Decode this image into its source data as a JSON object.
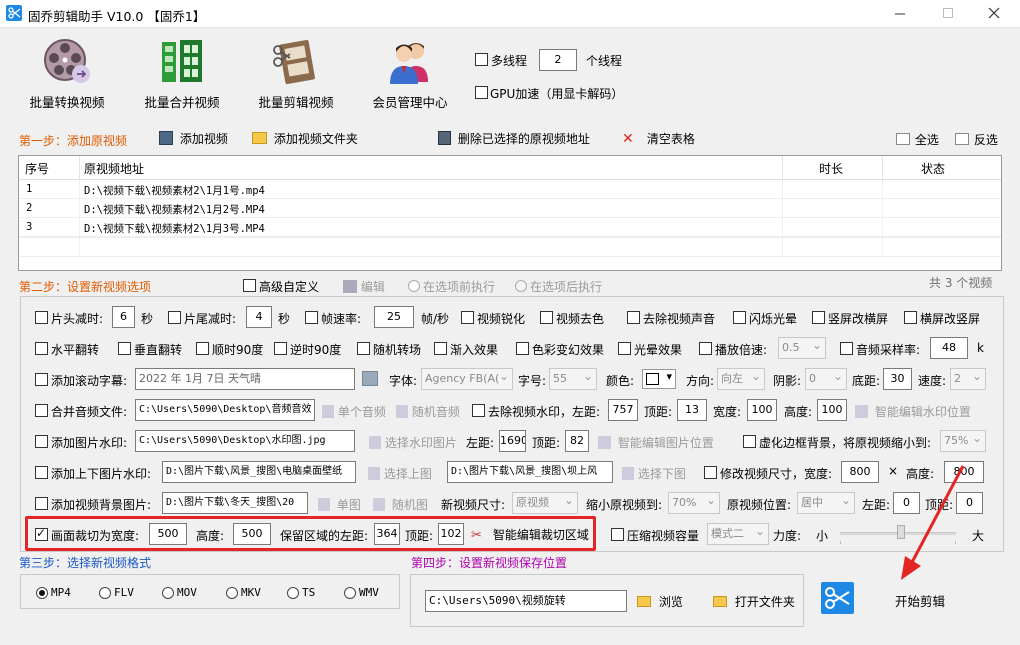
{
  "window": {
    "title": "固乔剪辑助手 V10.0 【固乔1】"
  },
  "toolbar": {
    "convert_label": "批量转换视频",
    "merge_label": "批量合并视频",
    "cut_label": "批量剪辑视频",
    "member_label": "会员管理中心",
    "multithread_label": "多线程",
    "thread_count": "2",
    "thread_unit": "个线程",
    "gpu_label": "GPU加速（用显卡解码）"
  },
  "step1": {
    "title": "第一步：添加原视频",
    "add_video": "添加视频",
    "add_folder": "添加视频文件夹",
    "delete_selected": "删除已选择的原视频地址",
    "clear_table": "清空表格",
    "select_all": "全选",
    "invert": "反选"
  },
  "table": {
    "headers": [
      "序号",
      "原视频地址",
      "时长",
      "状态"
    ],
    "rows": [
      [
        "1",
        "D:\\视频下载\\视频素材2\\1月1号.mp4",
        "",
        ""
      ],
      [
        "2",
        "D:\\视频下载\\视频素材2\\1月2号.MP4",
        "",
        ""
      ],
      [
        "3",
        "D:\\视频下载\\视频素材2\\1月3号.MP4",
        "",
        ""
      ]
    ]
  },
  "step2": {
    "title": "第二步：设置新视频选项",
    "advanced": "高级自定义",
    "edit": "编辑",
    "before_exec": "在选项前执行",
    "after_exec": "在选项后执行",
    "count_text": "共 3 个视频"
  },
  "opts": {
    "head_cut": "片头减时:",
    "head_val": "6",
    "sec1": "秒",
    "tail_cut": "片尾减时:",
    "tail_val": "4",
    "sec2": "秒",
    "fps": "帧速率:",
    "fps_val": "25",
    "fps_unit": "帧/秒",
    "sharpen": "视频锐化",
    "decolor": "视频去色",
    "mute": "去除视频声音",
    "flash": "闪烁光晕",
    "v2h": "竖屏改横屏",
    "h2v": "横屏改竖屏",
    "hflip": "水平翻转",
    "vflip": "垂直翻转",
    "rot90cw": "顺时90度",
    "rot90ccw": "逆时90度",
    "random_trans": "随机转场",
    "fade_in": "渐入效果",
    "color_effect": "色彩变幻效果",
    "halo": "光晕效果",
    "speed": "播放倍速:",
    "speed_val": "0.5",
    "sample_rate": "音频采样率:",
    "sample_val": "48",
    "sample_unit": "k",
    "scroll_sub": "添加滚动字幕:",
    "scroll_text": "2022 年 1月 7日 天气晴",
    "font_label": "字体:",
    "font_val": "Agency FB(A(",
    "size_label": "字号:",
    "size_val": "55",
    "color_label": "颜色:",
    "direction_label": "方向:",
    "direction_val": "向左",
    "shadow_label": "阴影:",
    "shadow_val": "0",
    "bottom_label": "底距:",
    "bottom_val": "30",
    "speed2_label": "速度:",
    "speed2_val": "2",
    "merge_audio": "合并音频文件:",
    "merge_audio_path": "C:\\Users\\5090\\Desktop\\音频音效",
    "single_audio": "单个音频",
    "random_audio": "随机音频",
    "remove_wm": "去除视频水印，左距:",
    "wm_left": "757",
    "wm_top_label": "顶距:",
    "wm_top": "13",
    "wm_w_label": "宽度:",
    "wm_w": "100",
    "wm_h_label": "高度:",
    "wm_h": "100",
    "smart_wm": "智能编辑水印位置",
    "img_wm": "添加图片水印:",
    "img_wm_path": "C:\\Users\\5090\\Desktop\\水印图.jpg",
    "choose_wm_img": "选择水印图片",
    "img_left_label": "左距:",
    "img_left": "1690",
    "img_top_label": "顶距:",
    "img_top": "82",
    "smart_img": "智能编辑图片位置",
    "blur_border": "虚化边框背景，将原视频缩小到:",
    "blur_val": "75%",
    "tb_wm": "添加上下图片水印:",
    "top_img_path": "D:\\图片下载\\风景_搜图\\电脑桌面壁纸",
    "choose_top": "选择上图",
    "bottom_img_path": "D:\\图片下载\\风景_搜图\\坝上风",
    "choose_bottom": "选择下图",
    "resize": "修改视频尺寸，宽度:",
    "resize_w": "800",
    "times": "×",
    "resize_h_label": "高度:",
    "resize_h": "800",
    "bg_img": "添加视频背景图片:",
    "bg_path": "D:\\图片下载\\冬天_搜图\\20",
    "single_img": "单图",
    "random_img": "随机图",
    "new_size_label": "新视频尺寸:",
    "new_size_val": "原视频",
    "shrink_label": "缩小原视频到:",
    "shrink_val": "70%",
    "pos_label": "原视频位置:",
    "pos_val": "居中",
    "bg_left_label": "左距:",
    "bg_left": "0",
    "bg_top_label": "顶距:",
    "bg_top": "0",
    "crop": "画面裁切为宽度:",
    "crop_w": "500",
    "crop_h_label": "高度:",
    "crop_h": "500",
    "crop_left_label": "保留区域的左距:",
    "crop_left": "364",
    "crop_top_label": "顶距:",
    "crop_top": "102",
    "smart_crop": "智能编辑裁切区域",
    "compress": "压缩视频容量",
    "mode_val": "模式二",
    "force_label": "力度:",
    "small": "小",
    "big": "大"
  },
  "step3": {
    "title": "第三步：选择新视频格式",
    "formats": [
      "MP4",
      "FLV",
      "MOV",
      "MKV",
      "TS",
      "WMV"
    ],
    "selected": "MP4"
  },
  "step4": {
    "title": "第四步：设置新视频保存位置",
    "path": "C:\\Users\\5090\\视频旋转",
    "browse": "浏览",
    "open_folder": "打开文件夹"
  },
  "start": {
    "label": "开始剪辑"
  },
  "colors": {
    "accent_red": "#e32525",
    "step_orange": "#e05a00",
    "step_blue": "#1a56c6",
    "step_purple": "#b000b0",
    "start_blue": "#1e88e5"
  }
}
